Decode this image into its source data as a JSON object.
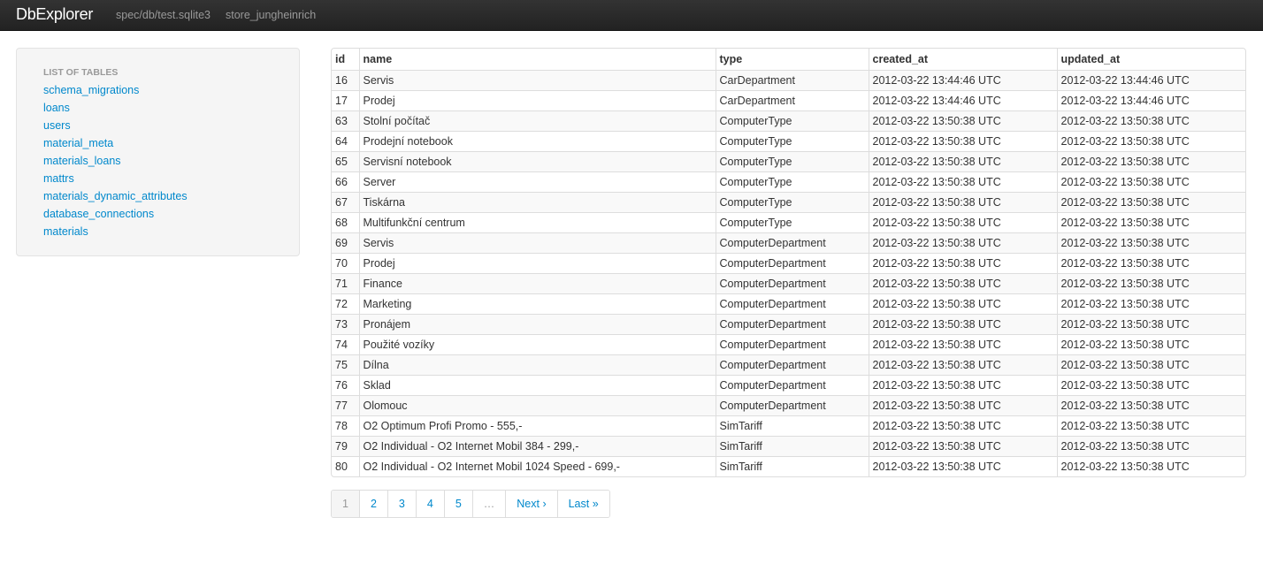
{
  "navbar": {
    "brand": "DbExplorer",
    "links": [
      "spec/db/test.sqlite3",
      "store_jungheinrich"
    ]
  },
  "sidebar": {
    "header": "LIST OF TABLES",
    "items": [
      "schema_migrations",
      "loans",
      "users",
      "material_meta",
      "materials_loans",
      "mattrs",
      "materials_dynamic_attributes",
      "database_connections",
      "materials"
    ]
  },
  "table": {
    "columns": [
      "id",
      "name",
      "type",
      "created_at",
      "updated_at"
    ],
    "rows": [
      [
        "16",
        "Servis",
        "CarDepartment",
        "2012-03-22 13:44:46 UTC",
        "2012-03-22 13:44:46 UTC"
      ],
      [
        "17",
        "Prodej",
        "CarDepartment",
        "2012-03-22 13:44:46 UTC",
        "2012-03-22 13:44:46 UTC"
      ],
      [
        "63",
        "Stolní počítač",
        "ComputerType",
        "2012-03-22 13:50:38 UTC",
        "2012-03-22 13:50:38 UTC"
      ],
      [
        "64",
        "Prodejní notebook",
        "ComputerType",
        "2012-03-22 13:50:38 UTC",
        "2012-03-22 13:50:38 UTC"
      ],
      [
        "65",
        "Servisní notebook",
        "ComputerType",
        "2012-03-22 13:50:38 UTC",
        "2012-03-22 13:50:38 UTC"
      ],
      [
        "66",
        "Server",
        "ComputerType",
        "2012-03-22 13:50:38 UTC",
        "2012-03-22 13:50:38 UTC"
      ],
      [
        "67",
        "Tiskárna",
        "ComputerType",
        "2012-03-22 13:50:38 UTC",
        "2012-03-22 13:50:38 UTC"
      ],
      [
        "68",
        "Multifunkční centrum",
        "ComputerType",
        "2012-03-22 13:50:38 UTC",
        "2012-03-22 13:50:38 UTC"
      ],
      [
        "69",
        "Servis",
        "ComputerDepartment",
        "2012-03-22 13:50:38 UTC",
        "2012-03-22 13:50:38 UTC"
      ],
      [
        "70",
        "Prodej",
        "ComputerDepartment",
        "2012-03-22 13:50:38 UTC",
        "2012-03-22 13:50:38 UTC"
      ],
      [
        "71",
        "Finance",
        "ComputerDepartment",
        "2012-03-22 13:50:38 UTC",
        "2012-03-22 13:50:38 UTC"
      ],
      [
        "72",
        "Marketing",
        "ComputerDepartment",
        "2012-03-22 13:50:38 UTC",
        "2012-03-22 13:50:38 UTC"
      ],
      [
        "73",
        "Pronájem",
        "ComputerDepartment",
        "2012-03-22 13:50:38 UTC",
        "2012-03-22 13:50:38 UTC"
      ],
      [
        "74",
        "Použité vozíky",
        "ComputerDepartment",
        "2012-03-22 13:50:38 UTC",
        "2012-03-22 13:50:38 UTC"
      ],
      [
        "75",
        "Dílna",
        "ComputerDepartment",
        "2012-03-22 13:50:38 UTC",
        "2012-03-22 13:50:38 UTC"
      ],
      [
        "76",
        "Sklad",
        "ComputerDepartment",
        "2012-03-22 13:50:38 UTC",
        "2012-03-22 13:50:38 UTC"
      ],
      [
        "77",
        "Olomouc",
        "ComputerDepartment",
        "2012-03-22 13:50:38 UTC",
        "2012-03-22 13:50:38 UTC"
      ],
      [
        "78",
        "O2 Optimum Profi Promo - 555,-",
        "SimTariff",
        "2012-03-22 13:50:38 UTC",
        "2012-03-22 13:50:38 UTC"
      ],
      [
        "79",
        "O2 Individual - O2 Internet Mobil 384 - 299,-",
        "SimTariff",
        "2012-03-22 13:50:38 UTC",
        "2012-03-22 13:50:38 UTC"
      ],
      [
        "80",
        "O2 Individual - O2 Internet Mobil 1024 Speed - 699,-",
        "SimTariff",
        "2012-03-22 13:50:38 UTC",
        "2012-03-22 13:50:38 UTC"
      ]
    ]
  },
  "pagination": {
    "pages": [
      "1",
      "2",
      "3",
      "4",
      "5"
    ],
    "current": "1",
    "gap": "…",
    "next": "Next ›",
    "last": "Last »"
  },
  "colors": {
    "navbar_bg": "#222222",
    "link": "#0088cc",
    "sidebar_bg": "#f5f5f5",
    "stripe": "#f9f9f9"
  }
}
